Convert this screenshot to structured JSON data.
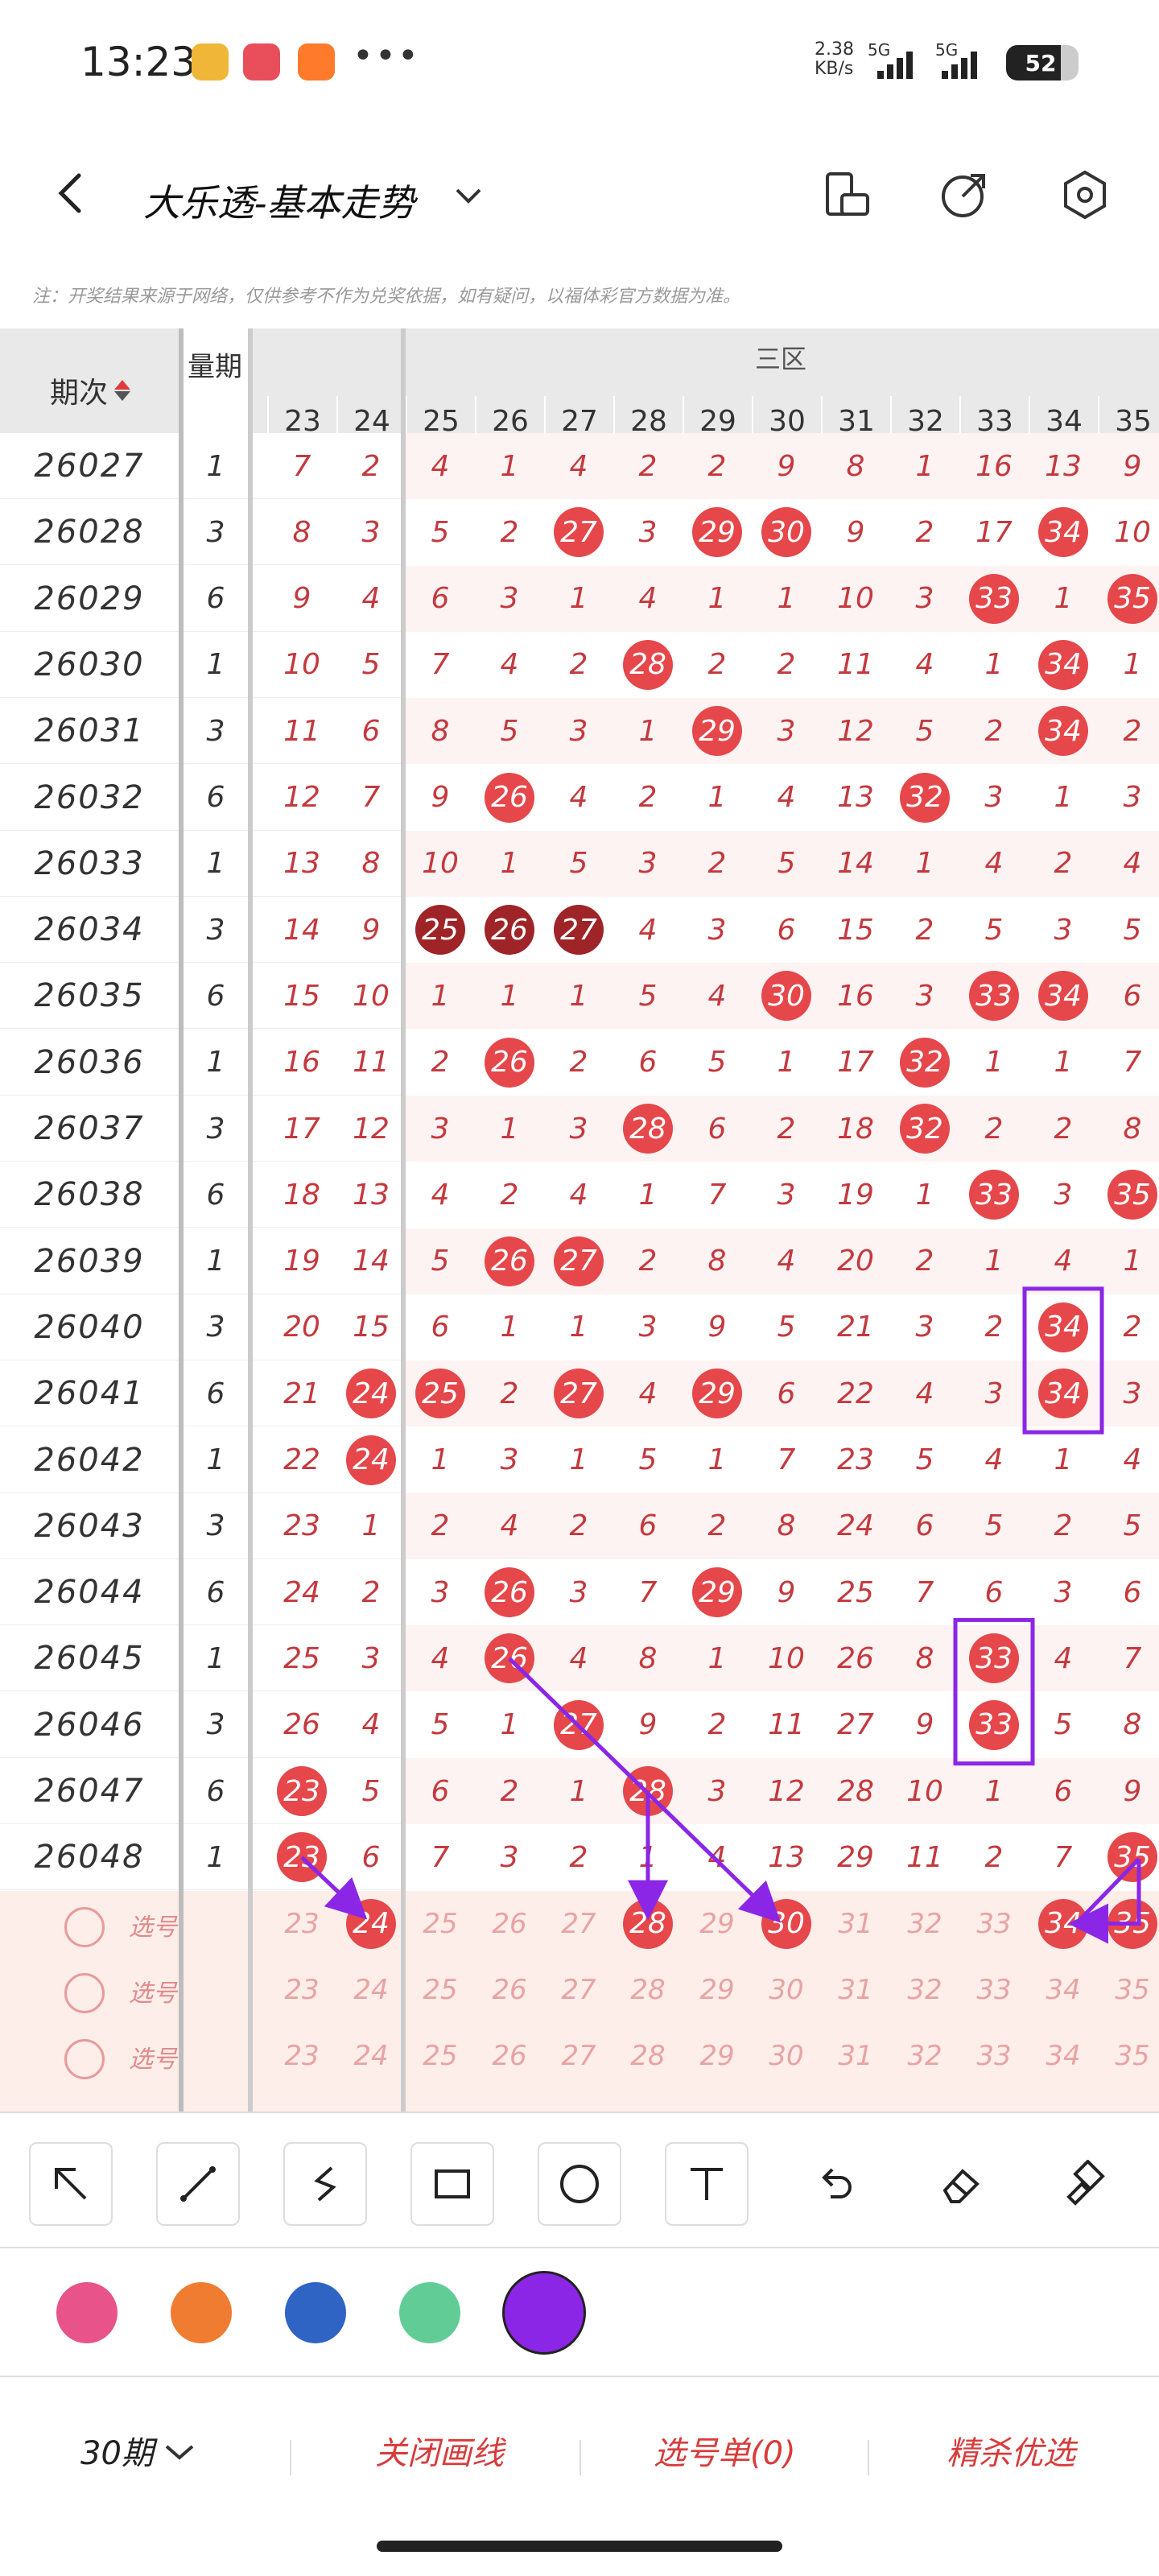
{
  "status_bar": {
    "time": "13:23",
    "more": "•••",
    "net_speed": "2.38",
    "net_unit": "KB/s",
    "signal1": "5G",
    "signal2": "5G",
    "battery": "52"
  },
  "header": {
    "title": "大乐透-基本走势"
  },
  "notice": "注：开奖结果来源于网络，仅供参考不作为兑奖依据，如有疑问，以福体彩官方数据为准。",
  "table": {
    "col_issue": "期次",
    "col_period": "量期",
    "zone_label": "三区",
    "numbers": [
      "23",
      "24",
      "25",
      "26",
      "27",
      "28",
      "29",
      "30",
      "31",
      "32",
      "33",
      "34",
      "35"
    ],
    "rows": [
      {
        "issue": "26027",
        "lq": "1",
        "vals": [
          "7",
          "2",
          "4",
          "1",
          "4",
          "2",
          "2",
          "9",
          "8",
          "1",
          "16",
          "13",
          "9"
        ],
        "hits": []
      },
      {
        "issue": "26028",
        "lq": "3",
        "vals": [
          "8",
          "3",
          "5",
          "2",
          "27",
          "3",
          "29",
          "30",
          "9",
          "2",
          "17",
          "34",
          "10"
        ],
        "hits": [
          4,
          6,
          7,
          11
        ]
      },
      {
        "issue": "26029",
        "lq": "6",
        "vals": [
          "9",
          "4",
          "6",
          "3",
          "1",
          "4",
          "1",
          "1",
          "10",
          "3",
          "33",
          "1",
          "35"
        ],
        "hits": [
          10,
          12
        ]
      },
      {
        "issue": "26030",
        "lq": "1",
        "vals": [
          "10",
          "5",
          "7",
          "4",
          "2",
          "28",
          "2",
          "2",
          "11",
          "4",
          "1",
          "34",
          "1"
        ],
        "hits": [
          5,
          11
        ]
      },
      {
        "issue": "26031",
        "lq": "3",
        "vals": [
          "11",
          "6",
          "8",
          "5",
          "3",
          "1",
          "29",
          "3",
          "12",
          "5",
          "2",
          "34",
          "2"
        ],
        "hits": [
          6,
          11
        ]
      },
      {
        "issue": "26032",
        "lq": "6",
        "vals": [
          "12",
          "7",
          "9",
          "26",
          "4",
          "2",
          "1",
          "4",
          "13",
          "32",
          "3",
          "1",
          "3"
        ],
        "hits": [
          3,
          9
        ]
      },
      {
        "issue": "26033",
        "lq": "1",
        "vals": [
          "13",
          "8",
          "10",
          "1",
          "5",
          "3",
          "2",
          "5",
          "14",
          "1",
          "4",
          "2",
          "4"
        ],
        "hits": []
      },
      {
        "issue": "26034",
        "lq": "3",
        "vals": [
          "14",
          "9",
          "25",
          "26",
          "27",
          "4",
          "3",
          "6",
          "15",
          "2",
          "5",
          "3",
          "5"
        ],
        "hits": [
          2,
          3,
          4
        ]
      },
      {
        "issue": "26035",
        "lq": "6",
        "vals": [
          "15",
          "10",
          "1",
          "1",
          "1",
          "5",
          "4",
          "30",
          "16",
          "3",
          "33",
          "34",
          "6"
        ],
        "hits": [
          7,
          10,
          11
        ]
      },
      {
        "issue": "26036",
        "lq": "1",
        "vals": [
          "16",
          "11",
          "2",
          "26",
          "2",
          "6",
          "5",
          "1",
          "17",
          "32",
          "1",
          "1",
          "7"
        ],
        "hits": [
          3,
          9
        ]
      },
      {
        "issue": "26037",
        "lq": "3",
        "vals": [
          "17",
          "12",
          "3",
          "1",
          "3",
          "28",
          "6",
          "2",
          "18",
          "32",
          "2",
          "2",
          "8"
        ],
        "hits": [
          5,
          9
        ]
      },
      {
        "issue": "26038",
        "lq": "6",
        "vals": [
          "18",
          "13",
          "4",
          "2",
          "4",
          "1",
          "7",
          "3",
          "19",
          "1",
          "33",
          "3",
          "35"
        ],
        "hits": [
          10,
          12
        ]
      },
      {
        "issue": "26039",
        "lq": "1",
        "vals": [
          "19",
          "14",
          "5",
          "26",
          "27",
          "2",
          "8",
          "4",
          "20",
          "2",
          "1",
          "4",
          "1"
        ],
        "hits": [
          3,
          4
        ]
      },
      {
        "issue": "26040",
        "lq": "3",
        "vals": [
          "20",
          "15",
          "6",
          "1",
          "1",
          "3",
          "9",
          "5",
          "21",
          "3",
          "2",
          "34",
          "2"
        ],
        "hits": [
          11
        ]
      },
      {
        "issue": "26041",
        "lq": "6",
        "vals": [
          "21",
          "24",
          "25",
          "2",
          "27",
          "4",
          "29",
          "6",
          "22",
          "4",
          "3",
          "34",
          "3"
        ],
        "hits": [
          1,
          2,
          4,
          6,
          11
        ]
      },
      {
        "issue": "26042",
        "lq": "1",
        "vals": [
          "22",
          "24",
          "1",
          "3",
          "1",
          "5",
          "1",
          "7",
          "23",
          "5",
          "4",
          "1",
          "4"
        ],
        "hits": [
          1
        ]
      },
      {
        "issue": "26043",
        "lq": "3",
        "vals": [
          "23",
          "1",
          "2",
          "4",
          "2",
          "6",
          "2",
          "8",
          "24",
          "6",
          "5",
          "2",
          "5"
        ],
        "hits": []
      },
      {
        "issue": "26044",
        "lq": "6",
        "vals": [
          "24",
          "2",
          "3",
          "26",
          "3",
          "7",
          "29",
          "9",
          "25",
          "7",
          "6",
          "3",
          "6"
        ],
        "hits": [
          3,
          6
        ]
      },
      {
        "issue": "26045",
        "lq": "1",
        "vals": [
          "25",
          "3",
          "4",
          "26",
          "4",
          "8",
          "1",
          "10",
          "26",
          "8",
          "33",
          "4",
          "7"
        ],
        "hits": [
          3,
          10
        ]
      },
      {
        "issue": "26046",
        "lq": "3",
        "vals": [
          "26",
          "4",
          "5",
          "1",
          "27",
          "9",
          "2",
          "11",
          "27",
          "9",
          "33",
          "5",
          "8"
        ],
        "hits": [
          4,
          10
        ]
      },
      {
        "issue": "26047",
        "lq": "6",
        "vals": [
          "23",
          "5",
          "6",
          "2",
          "1",
          "28",
          "3",
          "12",
          "28",
          "10",
          "1",
          "6",
          "9"
        ],
        "hits": [
          0,
          5
        ]
      },
      {
        "issue": "26048",
        "lq": "1",
        "vals": [
          "23",
          "6",
          "7",
          "3",
          "2",
          "1",
          "4",
          "13",
          "29",
          "11",
          "2",
          "7",
          "35"
        ],
        "hits": [
          0,
          12
        ]
      }
    ],
    "pick_label": "选号",
    "pick_rows": [
      {
        "selected": [
          1,
          5,
          7,
          11,
          12
        ]
      },
      {
        "selected": []
      },
      {
        "selected": []
      }
    ]
  },
  "toolbar": {
    "tools": [
      "arrow-pointer-icon",
      "line-icon",
      "freehand-icon",
      "rectangle-icon",
      "circle-icon",
      "text-icon",
      "undo-icon",
      "eraser-icon",
      "clear-icon"
    ]
  },
  "colors": {
    "swatches": [
      "#e8538a",
      "#ef7c31",
      "#2f63c4",
      "#62cc97",
      "#8b26e6"
    ],
    "selected": "#8b26e6"
  },
  "bottom": {
    "period": "30期",
    "close_drawing": "关闭画线",
    "pick_list": "选号单(0)",
    "smart_filter": "精杀优选"
  }
}
